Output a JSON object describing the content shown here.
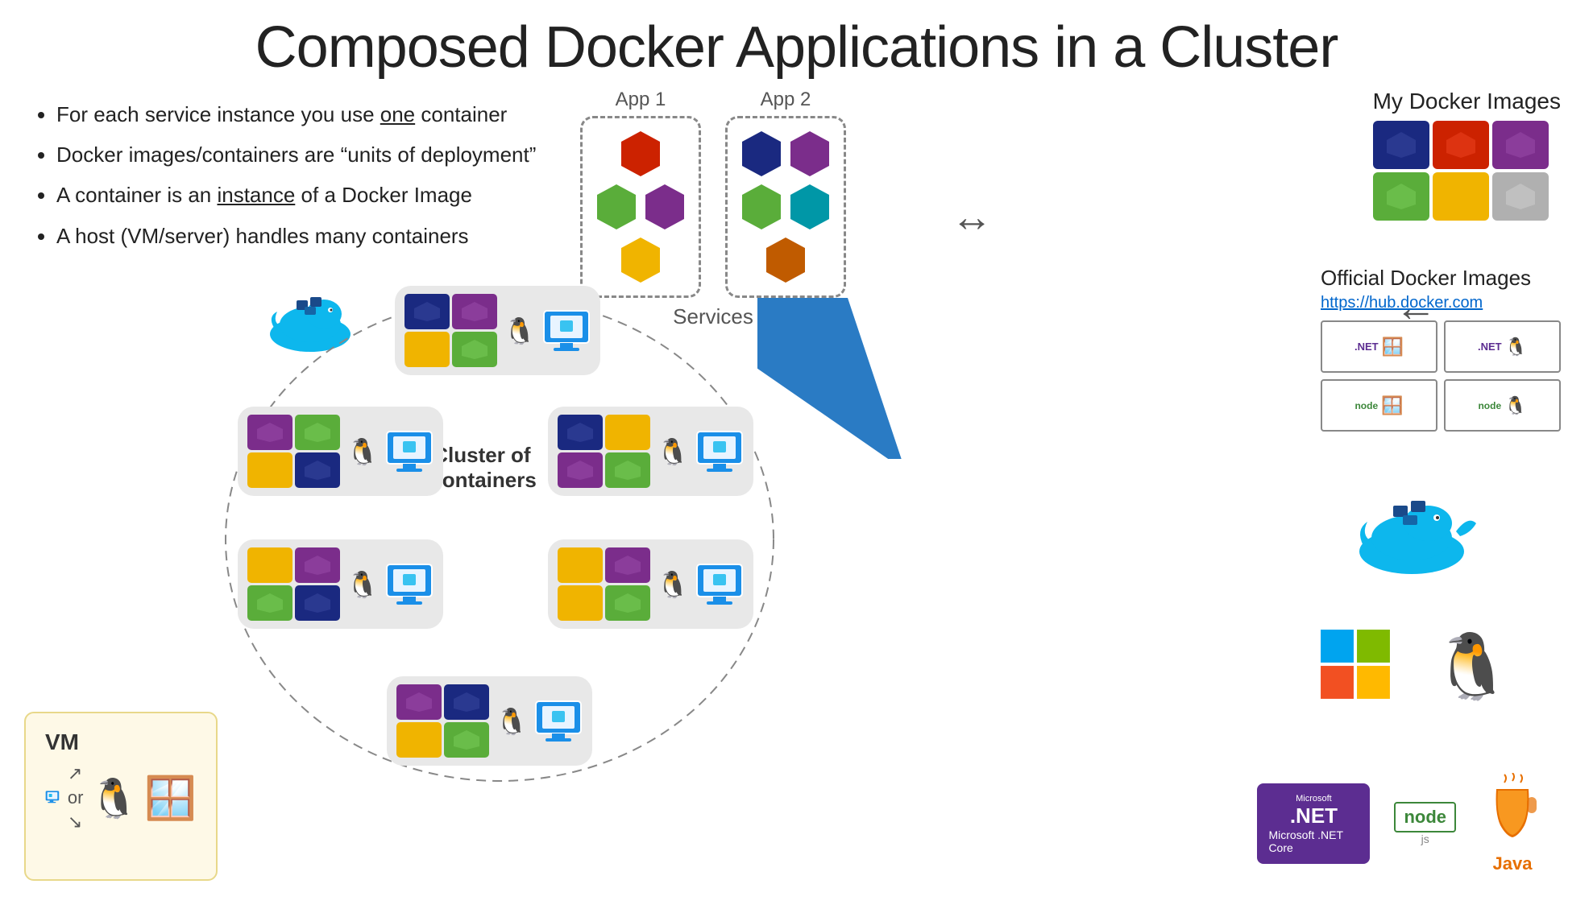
{
  "title": "Composed Docker Applications in a Cluster",
  "bullets": [
    {
      "text": "For each service instance you use ",
      "underline": "one",
      "after": " container"
    },
    {
      "text": "Docker images/containers are “units of deployment”"
    },
    {
      "text": "A container is an ",
      "underline": "instance",
      "after": " of a Docker Image"
    },
    {
      "text": "A host (VM/server) handles many containers"
    }
  ],
  "services": {
    "title": "Services",
    "app1_label": "App 1",
    "app2_label": "App 2"
  },
  "my_docker_images": {
    "title": "My Docker Images"
  },
  "official_docker": {
    "title": "Official Docker Images",
    "link": "https://hub.docker.com"
  },
  "cluster_label": "Cluster of\nContainers",
  "vm_box": {
    "label": "VM",
    "or_text": "or"
  },
  "tech_bottom": {
    "dotnet_label": "Microsoft\n.NET\nCore",
    "node_label": "node",
    "java_label": "Java"
  },
  "colors": {
    "dark_navy": "#1a2980",
    "purple": "#7b2d8b",
    "green": "#3da34f",
    "yellow": "#f0b400",
    "orange": "#c05b00",
    "red": "#cc0000",
    "teal": "#0097a7",
    "blue": "#0066cc",
    "docker_blue": "#0db7ed",
    "gray_cell": "#b0b0b0"
  }
}
